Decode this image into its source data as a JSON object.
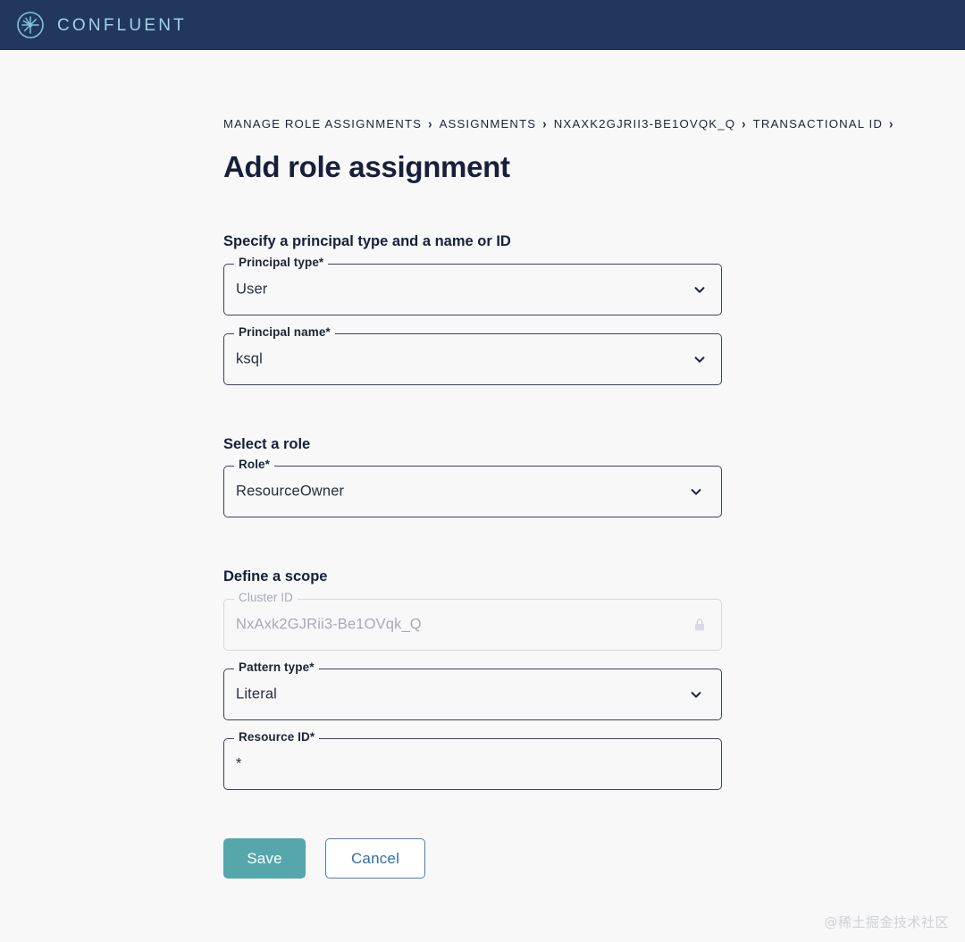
{
  "navbar": {
    "brand_name": "CONFLUENT",
    "brand_color": "#9fd3e8",
    "background": "#22375d"
  },
  "breadcrumb": {
    "separator": "›",
    "items": [
      "MANAGE ROLE ASSIGNMENTS",
      "ASSIGNMENTS",
      "NXAXK2GJRII3-BE1OVQK_Q",
      "TRANSACTIONAL ID"
    ]
  },
  "page": {
    "title": "Add role assignment"
  },
  "sections": [
    {
      "title": "Specify a principal type and a name or ID",
      "fields": [
        {
          "label": "Principal type*",
          "value": "User",
          "icon": "chevron-down-icon",
          "disabled": false
        },
        {
          "label": "Principal name*",
          "value": "ksql",
          "icon": "chevron-down-icon",
          "disabled": false
        }
      ]
    },
    {
      "title": "Select a role",
      "fields": [
        {
          "label": "Role*",
          "value": "ResourceOwner",
          "icon": "chevron-down-icon",
          "disabled": false
        }
      ]
    },
    {
      "title": "Define a scope",
      "fields": [
        {
          "label": "Cluster ID",
          "value": "NxAxk2GJRii3-Be1OVqk_Q",
          "icon": "lock-icon",
          "disabled": true
        },
        {
          "label": "Pattern type*",
          "value": "Literal",
          "icon": "chevron-down-icon",
          "disabled": false
        },
        {
          "label": "Resource ID*",
          "value": "*",
          "icon": "none",
          "disabled": false
        }
      ]
    }
  ],
  "actions": {
    "save_label": "Save",
    "cancel_label": "Cancel",
    "save_color": "#56a7ab",
    "cancel_color": "#2f6ea5"
  },
  "watermark": {
    "text": "@稀土掘金技术社区"
  }
}
